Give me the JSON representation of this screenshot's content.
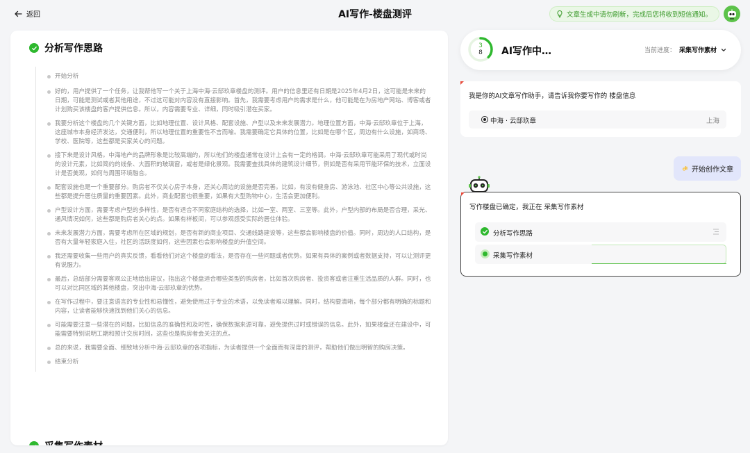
{
  "header": {
    "back_label": "返回",
    "title": "AI写作-楼盘测评",
    "notice": "文章生成中请勿刷新，完成后您将收到短信通知。"
  },
  "left": {
    "section_title": "分析写作思路",
    "thoughts": [
      "开始分析",
      "好的，用户提供了一个任务，让我帮他写一个关于上海中海·云邸玖章楼盘的测评。用户的信息里还有日期是2025年4月2日，这可能是未来的日期，可能是测试或者其他用途，不过这可能对内容没有直接影响。首先，我需要考虑用户的需求是什么，他可能是在为房地产网站、博客或者计划购买该楼盘的客户提供信息。所以，内容需要专业、详细，同时吸引潜在买家。",
      "我要分析这个楼盘的几个关键方面，比如地理位置、设计风格、配套设施、户型以及未来发展潜力。地理位置方面，中海·云邸玖章位于上海，这座城市本身经济发达，交通便利，所以地理位置的重要性不言而喻。我需要确定它具体的位置，比如是在哪个区，周边有什么设施，如商场、学校、医院等，这些都是买家关心的问题。",
      "接下来是设计风格。中海地产的品牌形象是比较高端的，所以他们的楼盘通常在设计上会有一定的格调。中海·云邸玖章可能采用了现代或时尚的设计元素，比如简约的线条、大面积的玻璃窗，或者是绿化景观。我需要查找具体的建筑设计细节，例如是否有采用节能环保的技术，立面设计是否美观，如何与周围环境融合。",
      "配套设施也是一个重要部分。购房者不仅关心房子本身，还关心周边的设施是否完善。比如，有没有健身房、游泳池、社区中心等公共设施，这些都是提升居住质量的重要因素。此外，商业配套也很重要，如果有大型购物中心，生活会更加便利。",
      "户型设计方面，需要考虑户型的多样性，是否有适合不同家庭结构的选择，比如一室、两室、三室等。此外，户型内部的布局是否合理，采光、通风情况如何，这些都是购房者关心的点。如果有样板间，可以参观感受实际的居住体验。",
      "未来发展潜力方面，需要考虑所在区域的规划，是否有新的商业项目、交通线路建设等，这些都会影响楼盘的价值。同时，周边的人口结构，是否有大量年轻家庭入住，社区的活跃度如何，这些因素也会影响楼盘的升值空间。",
      "我还需要收集一些用户的真实反馈，看看他们对这个楼盘的看法，是否存在一些问题或者优势。如果有具体的案例或者数据支持，可以让测评更有说服力。",
      "最后，总结部分需要客观公正地给出建议，指出这个楼盘适合哪些类型的购房者，比如首次购房者、投资客或者注重生活品质的人群。同时，也可以对比同区域的其他楼盘，突出中海·云邸玖章的优势。",
      "在写作过程中，要注意语言的专业性和易懂性，避免使用过于专业的术语，以免读者难以理解。同时，结构要清晰，每个部分都有明确的标题和内容，让读者能够快速找到他们关心的信息。",
      "可能需要注意一些潜在的问题，比如信息的准确性和及时性，确保数据来源可靠，避免提供过时或错误的信息。此外，如果楼盘还在建设中，可能需要特别说明工期和预计交房时间，这些也是购房者会关注的点。",
      "总的来说，我需要全面、细致地分析中海·云邸玖章的各项指标，为读者提供一个全面而有深度的测评，帮助他们做出明智的购房决策。",
      "结束分析"
    ],
    "next_section_title": "采集写作素材"
  },
  "progress": {
    "current": "3",
    "total": "8",
    "fraction": 0.375,
    "title": "AI写作中…",
    "stage_label": "当前进度：",
    "stage_value": "采集写作素材"
  },
  "chat": {
    "assistant_intro": "我是你的AI文章写作助手，请告诉我你要写作的 楼盘信息",
    "option_name": "中海 · 云邸玖章",
    "option_city": "上海",
    "user_message": "开始创作文章",
    "status_message": "写作楼盘已确定，我正在 采集写作素材",
    "steps": [
      {
        "label": "分析写作思路",
        "state": "done"
      },
      {
        "label": "采集写作素材",
        "state": "active"
      }
    ]
  },
  "colors": {
    "accent": "#2eb82e",
    "user_bubble": "#e2e6fb",
    "corner_mark": "#e94b3c"
  }
}
